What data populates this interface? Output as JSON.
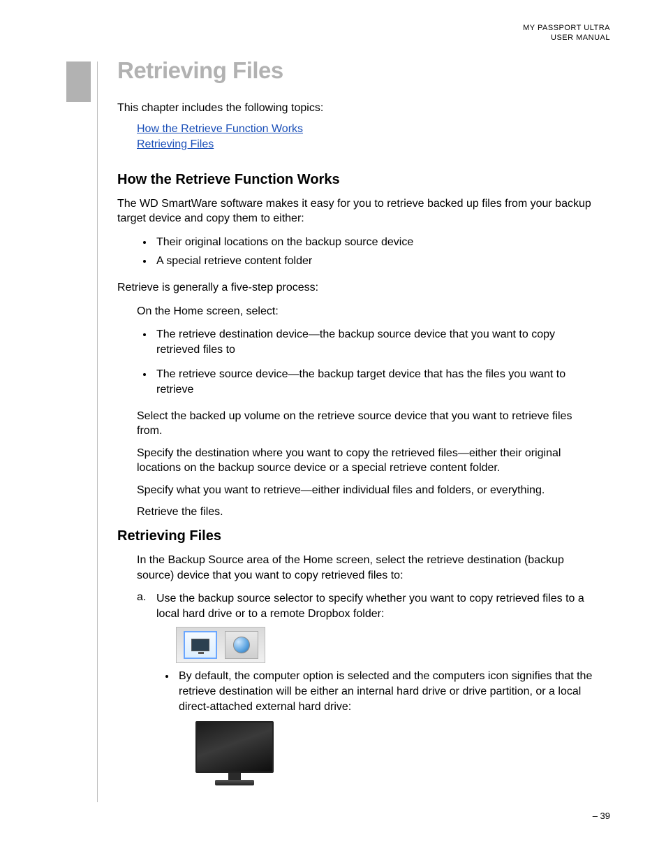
{
  "header": {
    "product": "MY PASSPORT ULTRA",
    "doc_type": "USER MANUAL"
  },
  "chapter": {
    "title": "Retrieving Files",
    "intro": "This chapter includes the following topics:",
    "topics": [
      "How the Retrieve Function Works",
      "Retrieving Files"
    ]
  },
  "section1": {
    "heading": "How the Retrieve Function Works",
    "para1": "The WD SmartWare software makes it easy for you to retrieve backed up files from your backup target device and copy them to either:",
    "bullets_a": [
      "Their original locations on the backup source device",
      "A special retrieve content folder"
    ],
    "para2": "Retrieve is generally a five-step process:",
    "step_intro": "On the Home screen, select:",
    "bullets_b": [
      "The retrieve destination device—the backup source device that you want to copy retrieved files to",
      "The retrieve source device—the backup target device that has the files you want to retrieve"
    ],
    "step2": "Select the backed up volume on the retrieve source device that you want to retrieve files from.",
    "step3": "Specify the destination where you want to copy the retrieved files—either their original locations on the backup source device or a special retrieve content folder.",
    "step4": "Specify what you want to retrieve—either individual files and folders, or everything.",
    "step5": "Retrieve the files."
  },
  "section2": {
    "heading": "Retrieving Files",
    "intro": "In the Backup Source area of the Home screen, select the retrieve destination (backup source) device that you want to copy retrieved files to:",
    "step_a_marker": "a.",
    "step_a_text": "Use the backup source selector to specify whether you want to copy retrieved files to a local hard drive or to a remote Dropbox folder:",
    "sub_bullet": "By default, the computer option is selected and the computers icon signifies that the retrieve destination will be either an internal hard drive or drive partition, or a local direct-attached external hard drive:"
  },
  "footer": {
    "page_number": "– 39"
  }
}
